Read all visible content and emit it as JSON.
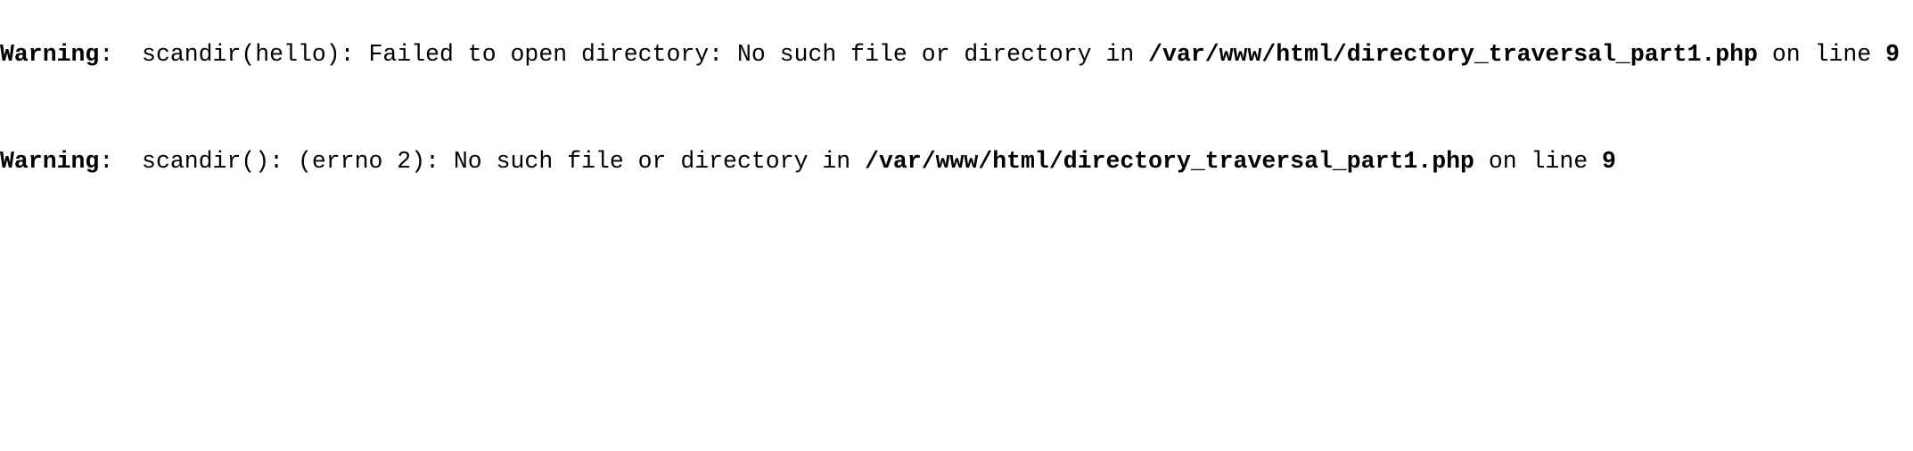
{
  "warnings": [
    {
      "label": "Warning",
      "message": "scandir(hello): Failed to open directory: No such file or directory in",
      "file": "/var/www/html/directory_traversal_part1.php",
      "on_line": "on line",
      "line": "9"
    },
    {
      "label": "Warning",
      "message": "scandir(): (errno 2): No such file or directory in",
      "file": "/var/www/html/directory_traversal_part1.php",
      "on_line": "on line",
      "line": "9"
    }
  ]
}
